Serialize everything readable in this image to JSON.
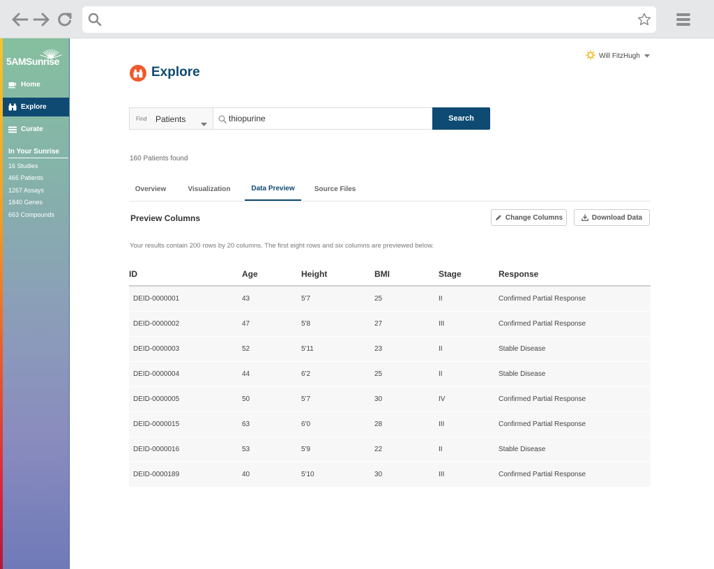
{
  "browser": {
    "url": "",
    "icons": [
      "back-arrow-icon",
      "forward-arrow-icon",
      "reload-icon",
      "search-icon",
      "star-icon",
      "menu-icon"
    ]
  },
  "sidebar": {
    "logo": "5AMSunrise",
    "nav": [
      {
        "label": "Home",
        "icon": "coffee-cup-icon",
        "active": false
      },
      {
        "label": "Explore",
        "icon": "binoculars-icon",
        "active": true
      },
      {
        "label": "Curate",
        "icon": "list-icon",
        "active": false
      }
    ],
    "section_title": "In Your Sunrise",
    "stats": [
      "16 Studies",
      "466 Patients",
      "1267 Assays",
      "1840 Genes",
      "663 Compounds"
    ]
  },
  "header": {
    "user_name": "Will FitzHugh",
    "page_title": "Explore"
  },
  "search": {
    "find_label": "Find",
    "find_value": "Patients",
    "query": "thiopurine",
    "button_label": "Search"
  },
  "results": {
    "count_text": "160 Patients found",
    "tabs": [
      {
        "label": "Overview",
        "active": false
      },
      {
        "label": "Visualization",
        "active": false
      },
      {
        "label": "Data Preview",
        "active": true
      },
      {
        "label": "Source Files",
        "active": false
      }
    ],
    "preview_title": "Preview Columns",
    "change_columns_label": "Change Columns",
    "download_label": "Download Data",
    "note": "Your results contain 200 rows by 20 columns. The first eight rows and six columns are previewed below."
  },
  "table": {
    "columns": [
      "ID",
      "Age",
      "Height",
      "BMI",
      "Stage",
      "Response"
    ],
    "rows": [
      [
        "DEID-0000001",
        "43",
        "5'7",
        "25",
        "II",
        "Confirmed Partial Response"
      ],
      [
        "DEID-0000002",
        "47",
        "5'8",
        "27",
        "III",
        "Confirmed Partial Response"
      ],
      [
        "DEID-0000003",
        "52",
        "5'11",
        "23",
        "II",
        "Stable Disease"
      ],
      [
        "DEID-0000004",
        "44",
        "6'2",
        "25",
        "II",
        "Stable Disease"
      ],
      [
        "DEID-0000005",
        "50",
        "5'7",
        "30",
        "IV",
        "Confirmed Partial Response"
      ],
      [
        "DEID-0000015",
        "63",
        "6'0",
        "28",
        "III",
        "Confirmed Partial Response"
      ],
      [
        "DEID-0000016",
        "53",
        "5'9",
        "22",
        "II",
        "Stable Disease"
      ],
      [
        "DEID-0000189",
        "40",
        "5'10",
        "30",
        "III",
        "Confirmed Partial Response"
      ]
    ]
  },
  "colors": {
    "brand_navy": "#0e4a72",
    "accent_orange": "#ee5a2a",
    "sun_yellow": "#f4b81f"
  }
}
